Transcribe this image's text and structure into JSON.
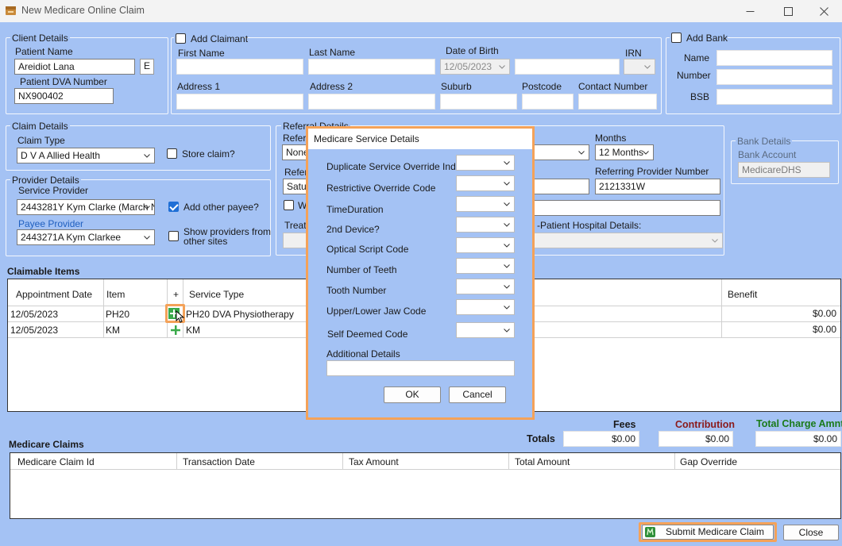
{
  "window": {
    "title": "New Medicare Online Claim"
  },
  "client": {
    "group": "Client Details",
    "patient_name_label": "Patient Name",
    "patient_name": "Areidiot Lana",
    "e_button": "E",
    "dva_label": "Patient DVA Number",
    "dva_number": "NX900402"
  },
  "claimant": {
    "checkbox_label": "Add Claimant",
    "first_name": "First Name",
    "last_name": "Last Name",
    "dob": "Date of Birth",
    "dob_value": "12/05/2023",
    "irn": "IRN",
    "address1": "Address 1",
    "address2": "Address 2",
    "suburb": "Suburb",
    "postcode": "Postcode",
    "contact": "Contact Number"
  },
  "bank": {
    "checkbox_label": "Add Bank",
    "name": "Name",
    "number": "Number",
    "bsb": "BSB"
  },
  "claim": {
    "group": "Claim Details",
    "type_label": "Claim Type",
    "type_value": "D V A Allied Health",
    "store_label": "Store claim?"
  },
  "provider": {
    "group": "Provider Details",
    "service_label": "Service Provider",
    "service_value": "2443281Y Kym Clarke (March N",
    "other_payee_label": "Add other payee?",
    "payee_label": "Payee Provider",
    "payee_value": "2443271A Kym Clarkee",
    "show_providers_line1": "Show providers from",
    "show_providers_line2": "other sites"
  },
  "referral": {
    "group": "Referral Details",
    "refer_label_partial": "Referr",
    "none_value": "None",
    "refer2_partial": "Refer",
    "date_partial": "Satu",
    "w_partial": "W",
    "treat_partial": "Treat",
    "months_label": "Months",
    "months_value": "12 Months",
    "ref_provider_label": "Referring Provider Number",
    "ref_provider_value": "2121331W",
    "hospital_label": "-Patient Hospital Details:"
  },
  "bank_details": {
    "group": "Bank Details",
    "account_label": "Bank Account",
    "account_value": "MedicareDHS"
  },
  "claimable": {
    "title": "Claimable Items",
    "columns": [
      "Appointment Date",
      "Item",
      "+",
      "Service Type",
      "Benefit"
    ],
    "rows": [
      {
        "date": "12/05/2023",
        "item": "PH20",
        "service": "PH20 DVA Physiotherapy",
        "benefit": "$0.00"
      },
      {
        "date": "12/05/2023",
        "item": "KM",
        "service": "KM",
        "benefit": "$0.00"
      }
    ]
  },
  "totals": {
    "fees_label": "Fees",
    "contribution_label": "Contribution",
    "total_charge_label": "Total Charge Amnt",
    "totals_label": "Totals",
    "fees": "$0.00",
    "contribution": "$0.00",
    "total_charge": "$0.00"
  },
  "medicare_claims": {
    "title": "Medicare Claims",
    "columns": [
      "Medicare Claim Id",
      "Transaction Date",
      "Tax Amount",
      "Total Amount",
      "Gap Override"
    ]
  },
  "footer": {
    "submit": "Submit Medicare Claim",
    "close": "Close"
  },
  "dialog": {
    "title": "Medicare Service Details",
    "fields": [
      "Duplicate Service Override Ind",
      "Restrictive Override Code",
      "TimeDuration",
      "2nd Device?",
      "Optical Script Code",
      "Number of Teeth",
      "Tooth Number",
      "Upper/Lower Jaw Code",
      "Self Deemed Code"
    ],
    "additional_label": "Additional Details",
    "ok": "OK",
    "cancel": "Cancel"
  },
  "colors": {
    "background": "#a4c2f4",
    "highlight": "#f4a259",
    "contribution": "#8b1a1a",
    "total_charge": "#1a7a1a",
    "payee_label": "#1f5fbf"
  }
}
